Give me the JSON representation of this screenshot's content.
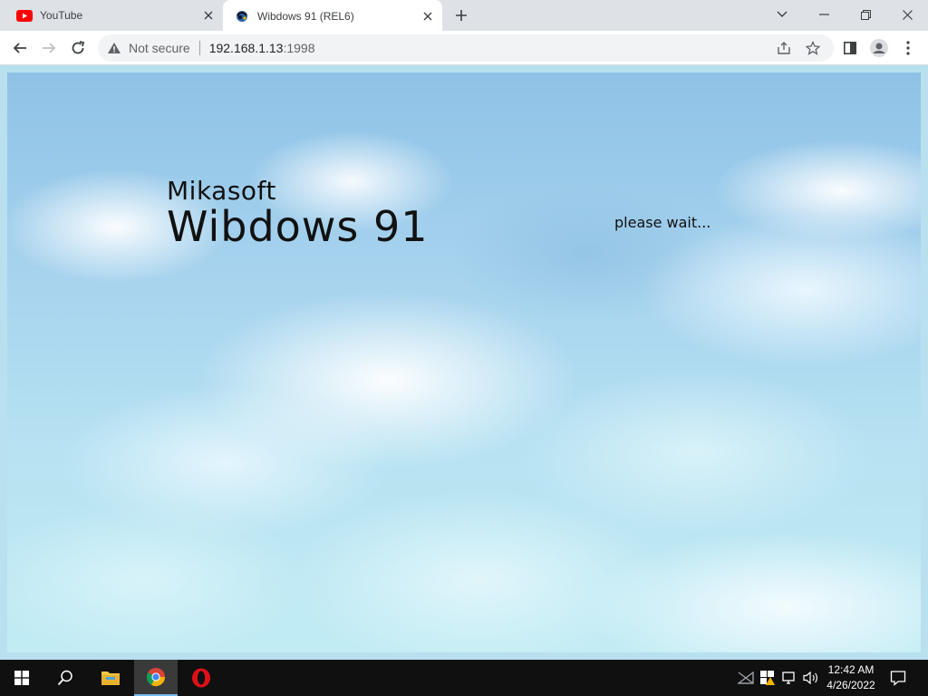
{
  "browser": {
    "tabs": [
      {
        "title": "YouTube",
        "favicon": "youtube-icon",
        "active": false
      },
      {
        "title": "Wibdows 91 (REL6)",
        "favicon": "wibdows-icon",
        "active": true
      }
    ],
    "address": {
      "security_label": "Not secure",
      "host": "192.168.1.13",
      "port": ":1998"
    }
  },
  "page": {
    "company": "Mikasoft",
    "product": "Wibdows 91",
    "status": "please wait..."
  },
  "taskbar": {
    "apps": [
      "start-icon",
      "search-icon",
      "file-explorer-icon",
      "chrome-icon",
      "opera-icon"
    ],
    "clock": {
      "time": "12:42 AM",
      "date": "4/26/2022"
    }
  },
  "colors": {
    "tab_strip": "#dee1e6",
    "sky_top": "#8ec2e6",
    "sky_bottom": "#c2ecf4",
    "taskbar": "#101010",
    "youtube_red": "#ff0000",
    "opera_red": "#e0101a"
  }
}
